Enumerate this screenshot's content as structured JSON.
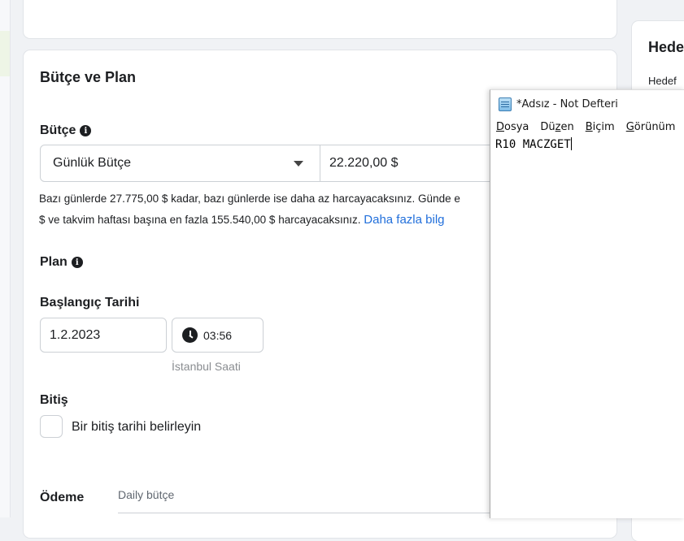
{
  "budget_plan": {
    "title": "Bütçe ve Plan",
    "budget_label": "Bütçe",
    "budget_type": "Günlük Bütçe",
    "budget_amount": "22.220,00 $",
    "helper_line1": "Bazı günlerde 27.775,00 $ kadar, bazı günlerde ise daha az harcayacaksınız. Günde e",
    "helper_line2": "$ ve takvim haftası başına en fazla 155.540,00 $ harcayacaksınız.",
    "learn_more": "Daha fazla bilg",
    "plan_label": "Plan",
    "start_date_label": "Başlangıç Tarihi",
    "start_date": "1.2.2023",
    "start_time": "03:56",
    "timezone": "İstanbul Saati",
    "end_label": "Bitiş",
    "end_checkbox_label": "Bir bitiş tarihi belirleyin",
    "payment_label": "Ödeme",
    "payment_placeholder": "Daily bütçe"
  },
  "right_panel": {
    "title": "Hede",
    "subtitle": "Hedef"
  },
  "notepad": {
    "title": "*Adsız - Not Defteri",
    "menu": [
      {
        "label": "Dosya",
        "key": "D",
        "rest": "osya"
      },
      {
        "label": "Düzen",
        "key": "z",
        "pre": "Dü",
        "rest": "en"
      },
      {
        "label": "Biçim",
        "key": "B",
        "rest": "içim"
      },
      {
        "label": "Görünüm",
        "key": "G",
        "rest": "örünüm"
      }
    ],
    "content": "R10 MACZGET"
  },
  "icons": {
    "info": "info-icon",
    "dropdown": "chevron-down-icon",
    "clock": "clock-icon",
    "notepad": "notepad-icon"
  }
}
